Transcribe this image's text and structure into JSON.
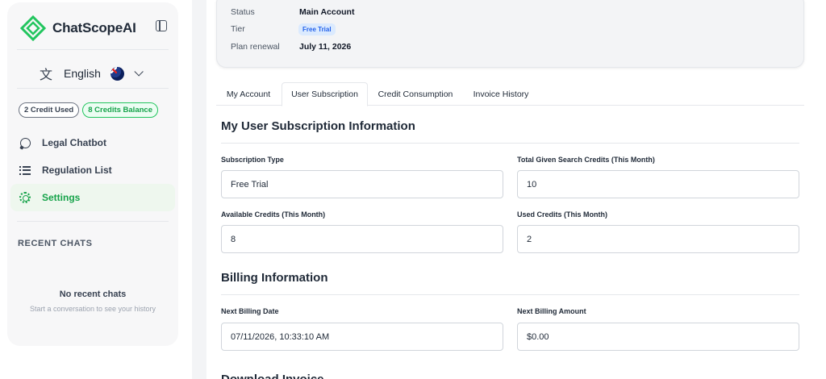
{
  "brand": {
    "name": "ChatScopeAI",
    "accent": "#22c55e"
  },
  "language": {
    "icon": "translate-icon",
    "label": "English"
  },
  "credits": {
    "used": "2 Credit Used",
    "balance": "8 Credits Balance"
  },
  "nav": [
    {
      "label": "Legal Chatbot",
      "icon": "chat-bubble-icon"
    },
    {
      "label": "Regulation List",
      "icon": "list-icon"
    },
    {
      "label": "Settings",
      "icon": "gear-icon",
      "active": true
    }
  ],
  "recent": {
    "title": "RECENT CHATS",
    "empty_title": "No recent chats",
    "empty_sub": "Start a conversation to see your history"
  },
  "account": {
    "status_key": "Status",
    "status_value": "Main Account",
    "tier_key": "Tier",
    "tier_value": "Free Trial",
    "renewal_key": "Plan renewal",
    "renewal_value": "July 11, 2026"
  },
  "tabs": [
    "My Account",
    "User Subscription",
    "Credit Consumption",
    "Invoice History"
  ],
  "active_tab": "User Subscription",
  "subscription": {
    "title": "My User Subscription Information",
    "type_label": "Subscription Type",
    "type_value": "Free Trial",
    "total_label": "Total Given Search Credits (This Month)",
    "total_value": "10",
    "available_label": "Available Credits (This Month)",
    "available_value": "8",
    "used_label": "Used Credits (This Month)",
    "used_value": "2"
  },
  "billing": {
    "title": "Billing Information",
    "date_label": "Next Billing Date",
    "date_value": "07/11/2026, 10:33:10 AM",
    "amount_label": "Next Billing Amount",
    "amount_value": "$0.00"
  },
  "download": {
    "title": "Download Invoice"
  }
}
